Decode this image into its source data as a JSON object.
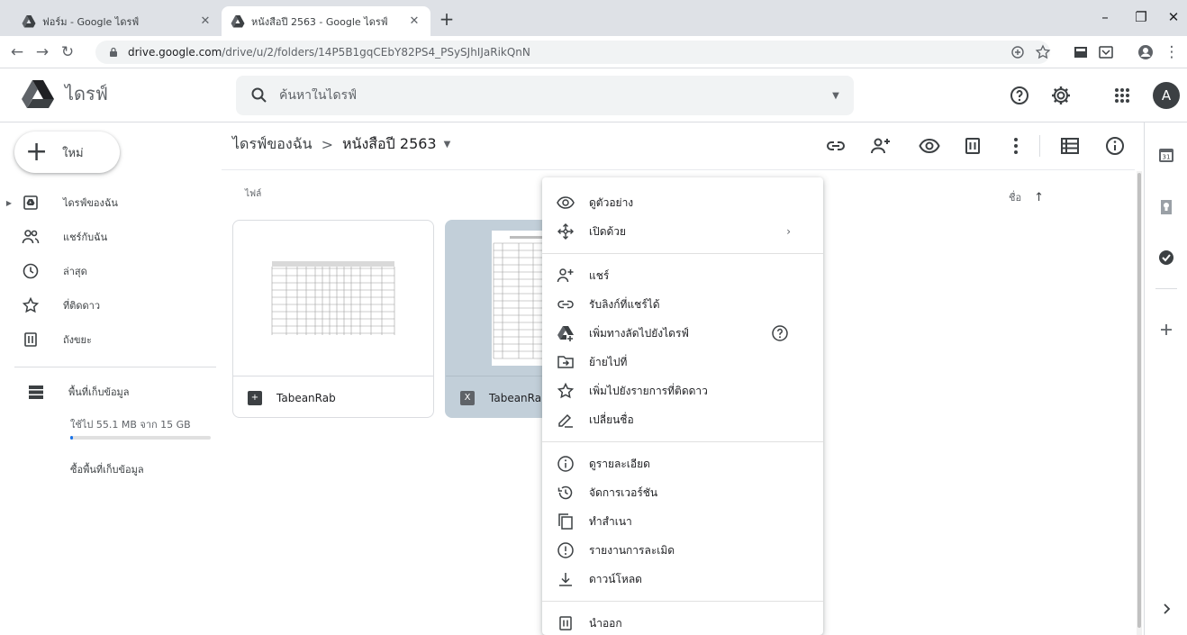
{
  "browser": {
    "tabs": [
      {
        "title": "ฟอร์ม - Google ไดรฟ์",
        "active": false
      },
      {
        "title": "หนังสือปี 2563 - Google ไดรฟ์",
        "active": true
      }
    ],
    "url_host": "drive.google.com",
    "url_path": "/drive/u/2/folders/14P5B1gqCEbY82PS4_PSySJhIJaRikQnN"
  },
  "header": {
    "app_name": "ไดรฟ์",
    "search_placeholder": "ค้นหาในไดรฟ์",
    "avatar_letter": "A"
  },
  "sidebar": {
    "new_label": "ใหม่",
    "items": [
      {
        "label": "ไดรฟ์ของฉัน",
        "icon": "my-drive-icon"
      },
      {
        "label": "แชร์กับฉัน",
        "icon": "shared-icon"
      },
      {
        "label": "ล่าสุด",
        "icon": "clock-icon"
      },
      {
        "label": "ที่ติดดาว",
        "icon": "star-icon"
      },
      {
        "label": "ถังขยะ",
        "icon": "trash-icon"
      }
    ],
    "storage_label": "พื้นที่เก็บข้อมูล",
    "storage_used": "ใช้ไป 55.1 MB จาก 15 GB",
    "storage_fraction": 0.004,
    "buy_storage": "ซื้อพื้นที่เก็บข้อมูล"
  },
  "main": {
    "breadcrumb_root": "ไดรฟ์ของฉัน",
    "breadcrumb_sep": ">",
    "breadcrumb_current": "หนังสือปี 2563",
    "section_label": "ไฟล์",
    "sort_label": "ชื่อ",
    "files": [
      {
        "name": "TabeanRab",
        "type": "google-sheets",
        "selected": false
      },
      {
        "name": "TabeanRab",
        "type": "excel",
        "selected": true
      }
    ]
  },
  "context_menu": {
    "groups": [
      [
        {
          "label": "ดูตัวอย่าง",
          "icon": "eye-icon"
        },
        {
          "label": "เปิดด้วย",
          "icon": "open-with-icon",
          "submenu": true
        }
      ],
      [
        {
          "label": "แชร์",
          "icon": "person-add-icon"
        },
        {
          "label": "รับลิงก์ที่แชร์ได้",
          "icon": "link-icon"
        },
        {
          "label": "เพิ่มทางลัดไปยังไดรฟ์",
          "icon": "add-shortcut-icon",
          "help": true
        },
        {
          "label": "ย้ายไปที่",
          "icon": "move-icon"
        },
        {
          "label": "เพิ่มไปยังรายการที่ติดดาว",
          "icon": "star-icon"
        },
        {
          "label": "เปลี่ยนชื่อ",
          "icon": "rename-icon"
        }
      ],
      [
        {
          "label": "ดูรายละเอียด",
          "icon": "info-icon"
        },
        {
          "label": "จัดการเวอร์ชัน",
          "icon": "history-icon"
        },
        {
          "label": "ทำสำเนา",
          "icon": "copy-icon"
        },
        {
          "label": "รายงานการละเมิด",
          "icon": "report-icon"
        },
        {
          "label": "ดาวน์โหลด",
          "icon": "download-icon"
        }
      ],
      [
        {
          "label": "นำออก",
          "icon": "trash-icon"
        }
      ]
    ]
  },
  "colors": {
    "selected_card": "#c2cfd9",
    "sheets_green": "#188038",
    "excel_gray": "#5f6368",
    "storage_fill": "#1a73e8"
  }
}
